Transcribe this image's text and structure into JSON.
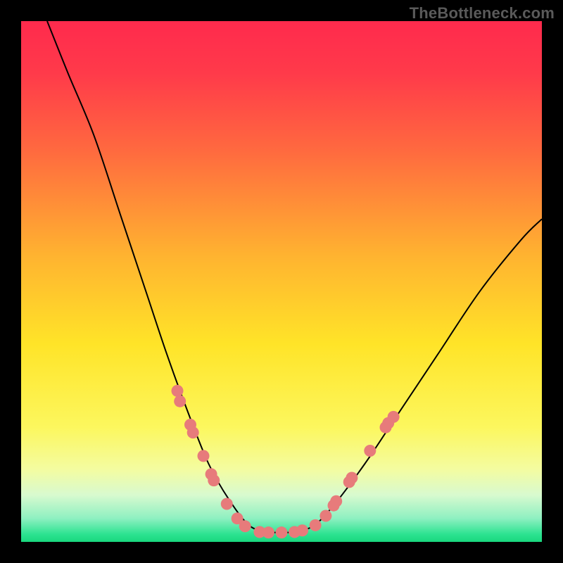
{
  "watermark": "TheBottleneck.com",
  "colors": {
    "frame": "#000000",
    "curve": "#000000",
    "dot_fill": "#e77b7b",
    "dot_stroke": "#c95a5a"
  },
  "chart_data": {
    "type": "line",
    "title": "",
    "xlabel": "",
    "ylabel": "",
    "xlim": [
      0,
      100
    ],
    "ylim": [
      0,
      100
    ],
    "gradient_stops": [
      {
        "offset": 0.0,
        "color": "#ff2a4d"
      },
      {
        "offset": 0.1,
        "color": "#ff3a4a"
      },
      {
        "offset": 0.25,
        "color": "#ff6a3f"
      },
      {
        "offset": 0.45,
        "color": "#ffb330"
      },
      {
        "offset": 0.62,
        "color": "#ffe428"
      },
      {
        "offset": 0.78,
        "color": "#fcf75e"
      },
      {
        "offset": 0.86,
        "color": "#f4fca0"
      },
      {
        "offset": 0.91,
        "color": "#d8facf"
      },
      {
        "offset": 0.955,
        "color": "#8ef0c1"
      },
      {
        "offset": 0.985,
        "color": "#2de391"
      },
      {
        "offset": 1.0,
        "color": "#19d87e"
      }
    ],
    "series": [
      {
        "name": "left-curve",
        "points": [
          {
            "x": 5,
            "y": 100
          },
          {
            "x": 9,
            "y": 90
          },
          {
            "x": 14,
            "y": 78
          },
          {
            "x": 19,
            "y": 63
          },
          {
            "x": 24,
            "y": 48
          },
          {
            "x": 28,
            "y": 36
          },
          {
            "x": 32,
            "y": 25
          },
          {
            "x": 36,
            "y": 15
          },
          {
            "x": 40,
            "y": 8
          },
          {
            "x": 44,
            "y": 3
          },
          {
            "x": 48,
            "y": 1.8
          }
        ]
      },
      {
        "name": "right-curve",
        "points": [
          {
            "x": 52,
            "y": 1.8
          },
          {
            "x": 56,
            "y": 3
          },
          {
            "x": 60,
            "y": 7
          },
          {
            "x": 66,
            "y": 15
          },
          {
            "x": 72,
            "y": 24
          },
          {
            "x": 80,
            "y": 36
          },
          {
            "x": 88,
            "y": 48
          },
          {
            "x": 96,
            "y": 58
          },
          {
            "x": 100,
            "y": 62
          }
        ]
      }
    ],
    "dots": [
      {
        "x": 30.0,
        "y": 29.0
      },
      {
        "x": 30.5,
        "y": 27.0
      },
      {
        "x": 32.5,
        "y": 22.5
      },
      {
        "x": 33.0,
        "y": 21.0
      },
      {
        "x": 35.0,
        "y": 16.5
      },
      {
        "x": 36.5,
        "y": 13.0
      },
      {
        "x": 37.0,
        "y": 11.8
      },
      {
        "x": 39.5,
        "y": 7.3
      },
      {
        "x": 41.5,
        "y": 4.5
      },
      {
        "x": 43.0,
        "y": 3.0
      },
      {
        "x": 45.8,
        "y": 1.9
      },
      {
        "x": 47.5,
        "y": 1.8
      },
      {
        "x": 50.0,
        "y": 1.8
      },
      {
        "x": 52.5,
        "y": 1.9
      },
      {
        "x": 54.0,
        "y": 2.2
      },
      {
        "x": 56.5,
        "y": 3.2
      },
      {
        "x": 58.5,
        "y": 5.0
      },
      {
        "x": 60.0,
        "y": 7.0
      },
      {
        "x": 60.5,
        "y": 7.8
      },
      {
        "x": 63.0,
        "y": 11.5
      },
      {
        "x": 63.5,
        "y": 12.3
      },
      {
        "x": 67.0,
        "y": 17.5
      },
      {
        "x": 70.0,
        "y": 22.0
      },
      {
        "x": 70.5,
        "y": 22.8
      },
      {
        "x": 71.5,
        "y": 24.0
      }
    ]
  }
}
